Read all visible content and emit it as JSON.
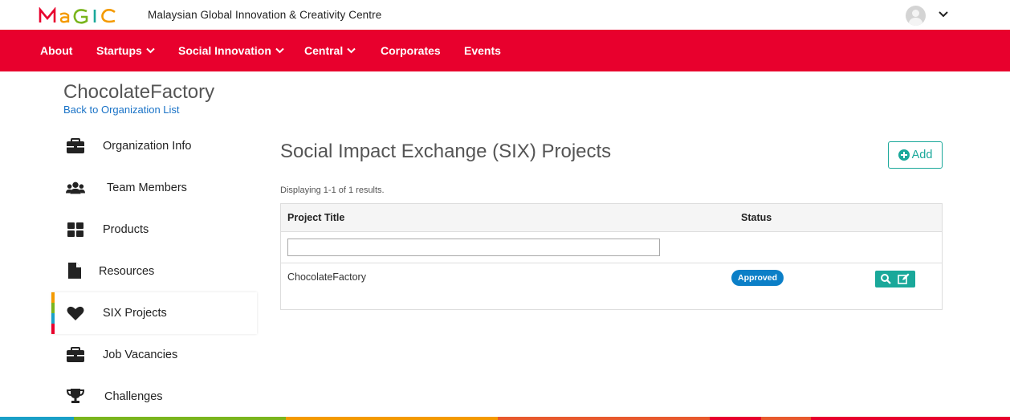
{
  "brand": {
    "logo_text": "MaGIC",
    "full_name": "Malaysian Global Innovation & Creativity Centre"
  },
  "nav": {
    "items": [
      {
        "label": "About",
        "has_dropdown": false
      },
      {
        "label": "Startups",
        "has_dropdown": true
      },
      {
        "label": "Social Innovation",
        "has_dropdown": true
      },
      {
        "label": "Central",
        "has_dropdown": true
      },
      {
        "label": "Corporates",
        "has_dropdown": false
      },
      {
        "label": "Events",
        "has_dropdown": false
      }
    ]
  },
  "header": {
    "org_name": "ChocolateFactory",
    "back_link": "Back to Organization List"
  },
  "sidebar": {
    "items": [
      {
        "label": "Organization Info",
        "icon": "briefcase-icon",
        "active": false
      },
      {
        "label": "Team Members",
        "icon": "users-icon",
        "active": false
      },
      {
        "label": "Products",
        "icon": "grid-icon",
        "active": false
      },
      {
        "label": "Resources",
        "icon": "file-icon",
        "active": false
      },
      {
        "label": "SIX Projects",
        "icon": "heart-icon",
        "active": true
      },
      {
        "label": "Job Vacancies",
        "icon": "briefcase-icon",
        "active": false
      },
      {
        "label": "Challenges",
        "icon": "trophy-icon",
        "active": false
      }
    ]
  },
  "main": {
    "heading": "Social Impact Exchange (SIX) Projects",
    "add_label": "Add",
    "summary": "Displaying 1-1 of 1 results.",
    "table": {
      "columns": [
        "Project Title",
        "Status"
      ],
      "filter_value": "",
      "rows": [
        {
          "title": "ChocolateFactory",
          "status": "Approved"
        }
      ]
    }
  },
  "colors": {
    "nav_red": "#e8002d",
    "accent_teal": "#1aa89a",
    "badge_blue": "#0b7fc7",
    "link_blue": "#1a73c7"
  }
}
